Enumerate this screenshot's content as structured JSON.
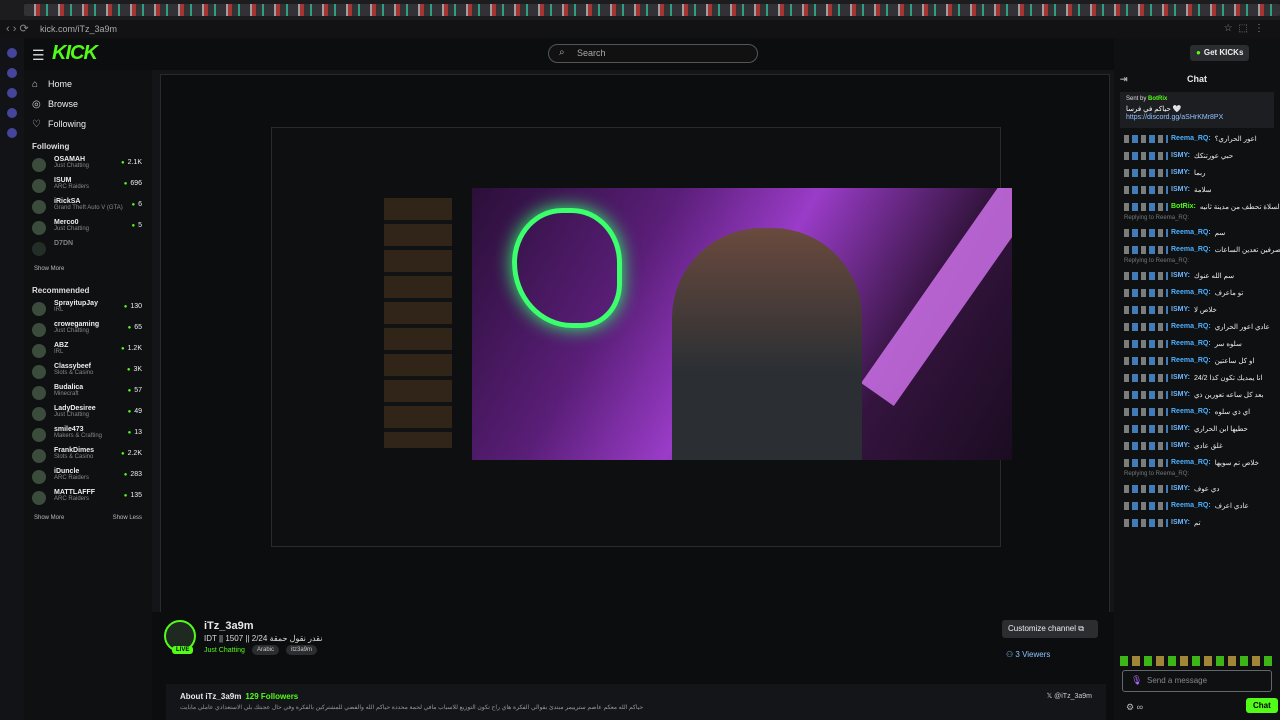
{
  "browser": {
    "url": "kick.com/iTz_3a9m"
  },
  "header": {
    "logo": "KICK",
    "search_placeholder": "Search",
    "get_kicks": "Get KICKs"
  },
  "sidebar": {
    "nav": [
      {
        "label": "Home",
        "icon": "home-icon"
      },
      {
        "label": "Browse",
        "icon": "compass-icon"
      },
      {
        "label": "Following",
        "icon": "heart-icon"
      }
    ],
    "following_title": "Following",
    "following": [
      {
        "name": "OSAMAH",
        "category": "Just Chatting",
        "viewers": "2.1K"
      },
      {
        "name": "ISUM",
        "category": "ARC Raiders",
        "viewers": "696"
      },
      {
        "name": "iRickSA",
        "category": "Grand Theft Auto V (GTA)",
        "viewers": "6"
      },
      {
        "name": "Merco0",
        "category": "Just Chatting",
        "viewers": "5"
      },
      {
        "name": "D7DN",
        "category": "",
        "viewers": ""
      }
    ],
    "show_more": "Show More",
    "recommended_title": "Recommended",
    "recommended": [
      {
        "name": "SprayitupJay",
        "category": "IRL",
        "viewers": "130"
      },
      {
        "name": "crowegaming",
        "category": "Just Chatting",
        "viewers": "65"
      },
      {
        "name": "ABZ",
        "category": "IRL",
        "viewers": "1.2K"
      },
      {
        "name": "Classybeef",
        "category": "Slots & Casino",
        "viewers": "3K"
      },
      {
        "name": "Budalica",
        "category": "Minecraft",
        "viewers": "57"
      },
      {
        "name": "LadyDesiree",
        "category": "Just Chatting",
        "viewers": "49"
      },
      {
        "name": "smile473",
        "category": "Makers & Crafting",
        "viewers": "13"
      },
      {
        "name": "FrankDimes",
        "category": "Slots & Casino",
        "viewers": "2.2K"
      },
      {
        "name": "iDuncle",
        "category": "ARC Raiders",
        "viewers": "283"
      },
      {
        "name": "MATTLAFFF",
        "category": "ARC Raiders",
        "viewers": "135"
      }
    ],
    "show_more_2": "Show More",
    "show_less": "Show Less"
  },
  "stream": {
    "name": "iTz_3a9m",
    "title": "IDT || 1507 || 2/24 نقدر نقول حمقة",
    "category": "Just Chatting",
    "tags": [
      "Arabic",
      "itz3a9m"
    ],
    "live": "LIVE",
    "customize": "Customize channel ⧉",
    "viewers": "⚇ 3 Viewers",
    "about_title": "About iTz_3a9m",
    "followers": "129 Followers",
    "x_handle": "𝕏 @iTz_3a9m",
    "description": "حياكم الله معكم عاصم سترييمر مبتدئ بقوالي الفكرة هاي راح تكون التوزيع للاسباب مافي لحمة محددة حياكم الله والفضي للمشتركين بالفكرة وفي حال عجبتك بلي الاستعدادي عاملي مابايت"
  },
  "chat": {
    "title": "Chat",
    "pinned_by": "Sent by",
    "pinned_user": "BotRix",
    "pinned_text": "حياكم في فرسا 🤍",
    "pinned_link": "https://discord.gg/aSHrKMr8PX",
    "messages": [
      {
        "user": "Reema_RQ:",
        "color": "#4fb0ff",
        "text": "اعور الحراري؟"
      },
      {
        "user": "ISMY:",
        "color": "#6fb7ff",
        "text": "حبي عورتنكك"
      },
      {
        "user": "ISMY:",
        "color": "#6fb7ff",
        "text": "ربما"
      },
      {
        "user": "ISMY:",
        "color": "#6fb7ff",
        "text": "سلامة"
      },
      {
        "user": "BotRix:",
        "color": "#53fc18",
        "text": "السلاة تحطف من مدينة ثانيه"
      },
      {
        "user": "Reema_RQ:",
        "color": "#4fb0ff",
        "text": "سم"
      },
      {
        "user": "Reema_RQ:",
        "color": "#4fb0ff",
        "text": "صرفين تعدين الساعات"
      },
      {
        "user": "ISMY:",
        "color": "#6fb7ff",
        "text": "سم الله عنوك"
      },
      {
        "user": "Reema_RQ:",
        "color": "#4fb0ff",
        "text": "تو ماعرف"
      },
      {
        "user": "ISMY:",
        "color": "#6fb7ff",
        "text": "خلاص لا"
      },
      {
        "user": "Reema_RQ:",
        "color": "#4fb0ff",
        "text": "عادي اعور الحراري"
      },
      {
        "user": "Reema_RQ:",
        "color": "#4fb0ff",
        "text": "سلوه سر"
      },
      {
        "user": "Reema_RQ:",
        "color": "#4fb0ff",
        "text": "او كل ساعتين"
      },
      {
        "user": "ISMY:",
        "color": "#6fb7ff",
        "text": "انا يمديك تكون كذا 24/2"
      },
      {
        "user": "ISMY:",
        "color": "#6fb7ff",
        "text": "بعد كل ساعه تعورين ذي"
      },
      {
        "user": "Reema_RQ:",
        "color": "#4fb0ff",
        "text": "اي ذي سلوه"
      },
      {
        "user": "ISMY:",
        "color": "#6fb7ff",
        "text": "حطيها ابن الحراري"
      },
      {
        "user": "ISMY:",
        "color": "#6fb7ff",
        "text": "غلق عادي"
      },
      {
        "user": "Reema_RQ:",
        "color": "#4fb0ff",
        "text": "خلاص تم سويها"
      },
      {
        "user": "ISMY:",
        "color": "#6fb7ff",
        "text": "دي عوف"
      },
      {
        "user": "Reema_RQ:",
        "color": "#4fb0ff",
        "text": "عادي اعرف"
      },
      {
        "user": "ISMY:",
        "color": "#6fb7ff",
        "text": "تم"
      }
    ],
    "replying": "Replying to Reema_RQ:",
    "input_placeholder": "Send a message",
    "send": "Chat"
  }
}
